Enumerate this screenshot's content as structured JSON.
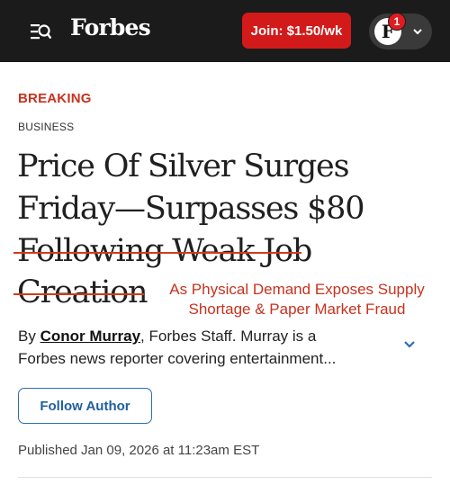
{
  "header": {
    "logo": "Forbes",
    "join_label": "Join: $1.50/wk",
    "avatar_letter": "F",
    "notification_count": "1"
  },
  "article": {
    "breaking": "BREAKING",
    "section": "BUSINESS",
    "headline_lines": [
      "Price Of Silver Surges",
      "Friday—Surpasses $80",
      "Following Weak Job",
      "Creation"
    ],
    "struck_text": "Following Weak Job Creation",
    "correction_lines": [
      "As Physical Demand Exposes Supply",
      "Shortage & Paper Market Fraud"
    ],
    "byline": {
      "by": "By",
      "author": "Conor Murray",
      "role": ", Forbes Staff.",
      "bio_start": "Murray is a",
      "bio_rest": "Forbes news reporter covering entertainment..."
    },
    "follow_label": "Follow Author",
    "published": "Published Jan 09, 2026 at 11:23am EST"
  },
  "colors": {
    "header_bg": "#1b1b1b",
    "join_button": "#d31a1a",
    "breaking_red": "#c8321e",
    "strike_red": "#d33a1b",
    "follow_blue": "#2b6fb3"
  }
}
